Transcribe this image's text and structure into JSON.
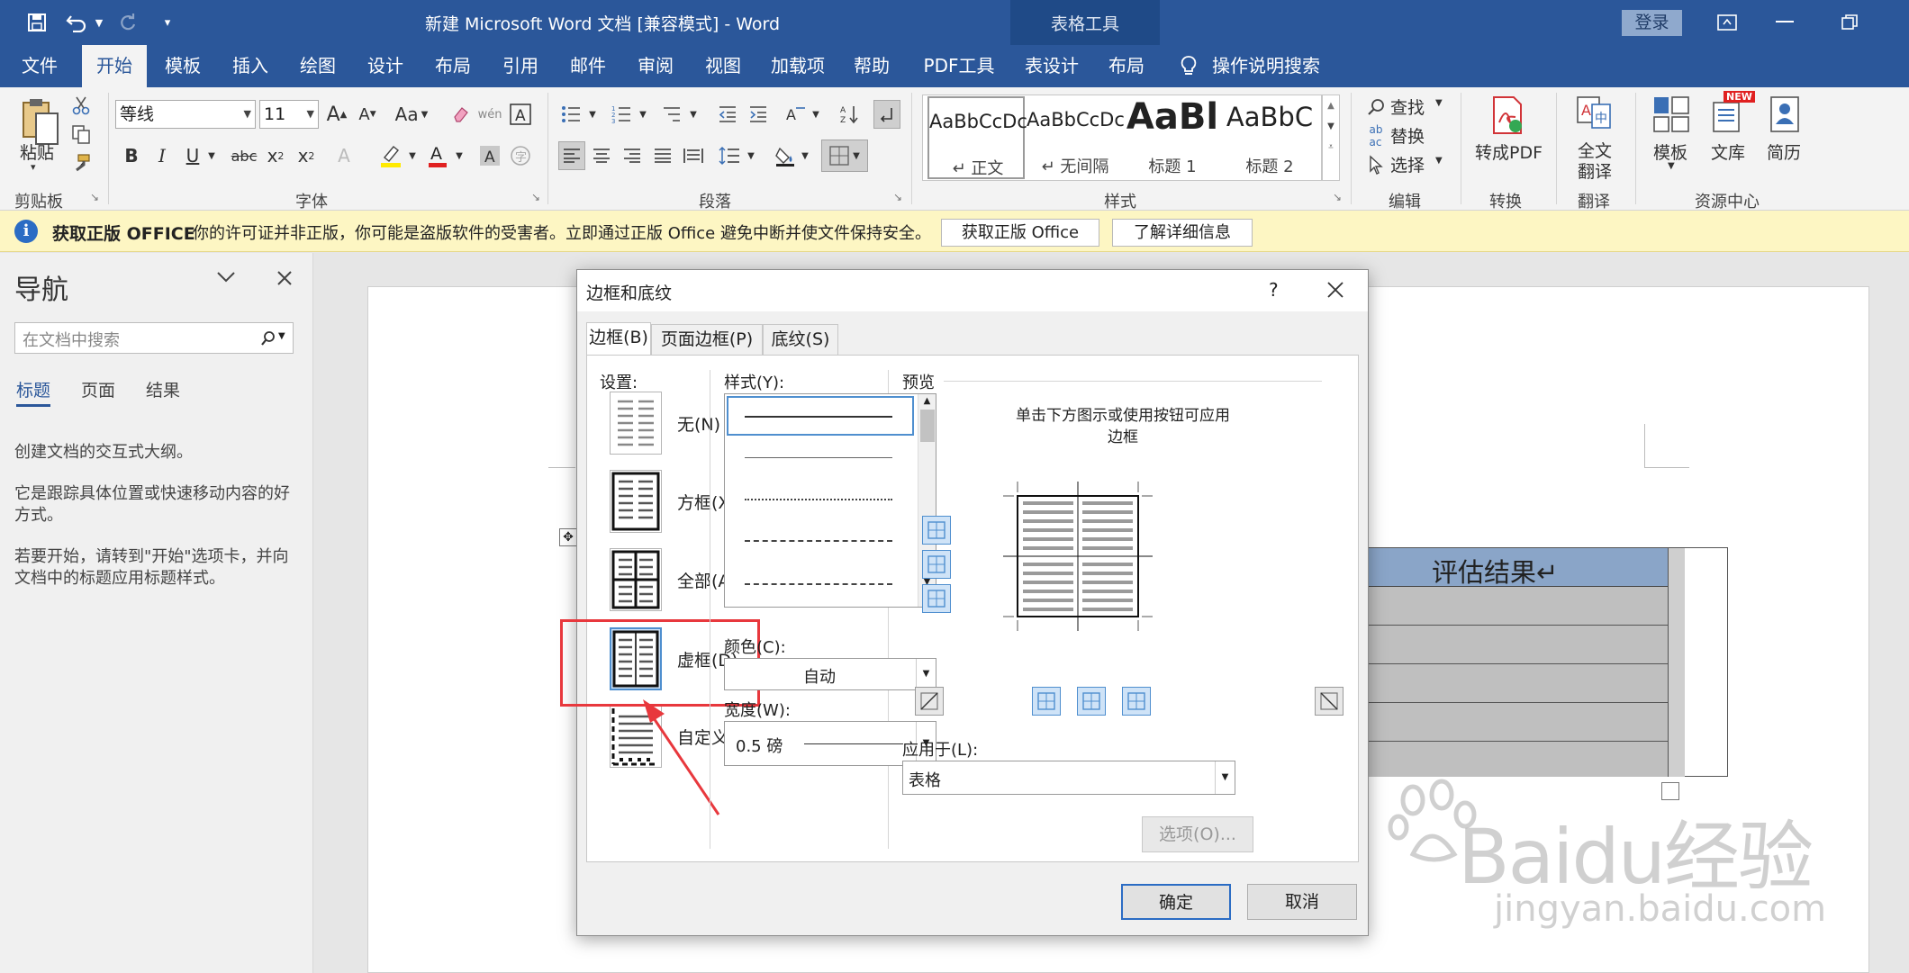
{
  "window": {
    "title": "新建 Microsoft Word 文档 [兼容模式] - Word",
    "context_tab_group": "表格工具",
    "login": "登录"
  },
  "tabs": [
    "文件",
    "开始",
    "模板",
    "插入",
    "绘图",
    "设计",
    "布局",
    "引用",
    "邮件",
    "审阅",
    "视图",
    "加载项",
    "帮助",
    "PDF工具",
    "表设计",
    "布局"
  ],
  "active_tab": "开始",
  "tell_me": "操作说明搜索",
  "ribbon": {
    "clipboard": {
      "paste": "粘贴",
      "label": "剪贴板"
    },
    "font": {
      "font_name": "等线",
      "font_size": "11",
      "label": "字体",
      "case_btn": "Aa"
    },
    "paragraph": {
      "label": "段落"
    },
    "styles": {
      "label": "样式",
      "items": [
        {
          "sample": "AaBbCcDc",
          "name": "↵ 正文"
        },
        {
          "sample": "AaBbCcDc",
          "name": "↵ 无间隔"
        },
        {
          "sample": "AaBl",
          "name": "标题 1"
        },
        {
          "sample": "AaBbC",
          "name": "标题 2"
        }
      ]
    },
    "editing": {
      "find": "查找",
      "replace": "替换",
      "select": "选择",
      "label": "编辑"
    },
    "convert": {
      "to_pdf": "转成PDF",
      "label": "转换"
    },
    "translate": {
      "full": "全文",
      "full2": "翻译",
      "label": "翻译"
    },
    "resources": {
      "template": "模板",
      "library": "文库",
      "resume": "简历",
      "new_badge": "NEW",
      "label": "资源中心"
    }
  },
  "notice": {
    "title": "获取正版 OFFICE",
    "message": "你的许可证并非正版，你可能是盗版软件的受害者。立即通过正版 Office 避免中断并使文件保持安全。",
    "btn_get": "获取正版 Office",
    "btn_more": "了解详细信息"
  },
  "nav_pane": {
    "title": "导航",
    "search_placeholder": "在文档中搜索",
    "tabs": [
      "标题",
      "页面",
      "结果"
    ],
    "p1": "创建文档的交互式大纲。",
    "p2": "它是跟踪具体位置或快速移动内容的好方式。",
    "p3": "若要开始，请转到\"开始\"选项卡，并向文档中的标题应用标题样式。"
  },
  "document": {
    "table_header": "评估结果↵"
  },
  "dialog": {
    "title": "边框和底纹",
    "help": "?",
    "tabs": [
      "边框(B)",
      "页面边框(P)",
      "底纹(S)"
    ],
    "setting_label": "设置:",
    "settings": [
      "无(N)",
      "方框(X)",
      "全部(A)",
      "虚框(D)",
      "自定义(U)"
    ],
    "selected_setting": "虚框(D)",
    "style_label": "样式(Y):",
    "color_label": "颜色(C):",
    "color_value": "自动",
    "width_label": "宽度(W):",
    "width_value": "0.5 磅",
    "preview_label": "预览",
    "preview_hint": "单击下方图示或使用按钮可应用",
    "preview_hint2": "边框",
    "apply_label": "应用于(L):",
    "apply_value": "表格",
    "options": "选项(O)...",
    "ok": "确定",
    "cancel": "取消"
  },
  "watermark": {
    "brand": "Baidu经验",
    "url": "jingyan.baidu.com"
  },
  "colors": {
    "accent": "#2b579a",
    "highlight": "#e8383d",
    "notice_bg": "#fdf6c3"
  }
}
